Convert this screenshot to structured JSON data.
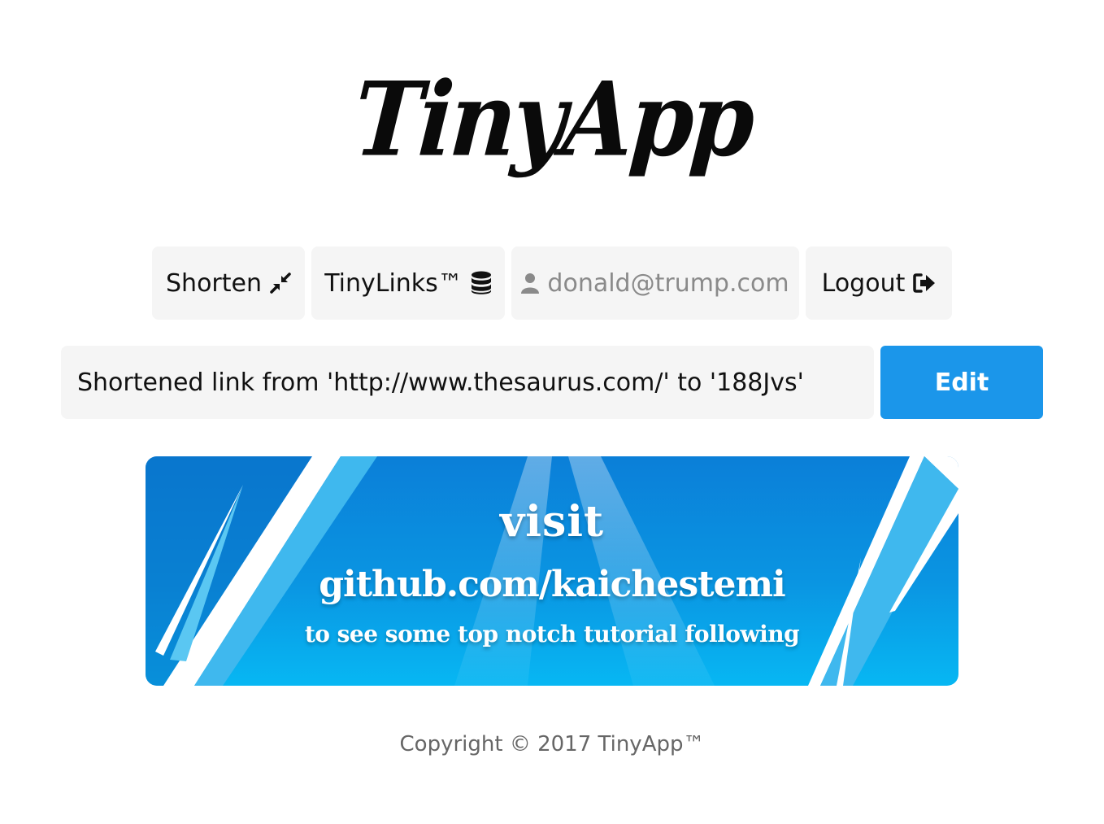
{
  "logo": {
    "text": "TinyApp"
  },
  "nav": {
    "shorten_label": "Shorten",
    "shorten_icon": "compress-icon",
    "links_label": "TinyLinks™",
    "links_icon": "database-icon",
    "user_email": "donald@trump.com",
    "user_icon": "user-icon",
    "logout_label": "Logout",
    "logout_icon": "sign-out-icon"
  },
  "message": {
    "text": "Shortened link from 'http://www.thesaurus.com/' to '188Jvs'",
    "edit_label": "Edit"
  },
  "banner": {
    "line1": "visit",
    "line2": "github.com/kaichestemi",
    "line3": "to see some top notch tutorial following"
  },
  "footer": {
    "text": "Copyright © 2017 TinyApp™"
  },
  "colors": {
    "accent": "#1b96ea",
    "nav_bg": "#f5f5f5",
    "banner_blue": "#0a95e2"
  }
}
